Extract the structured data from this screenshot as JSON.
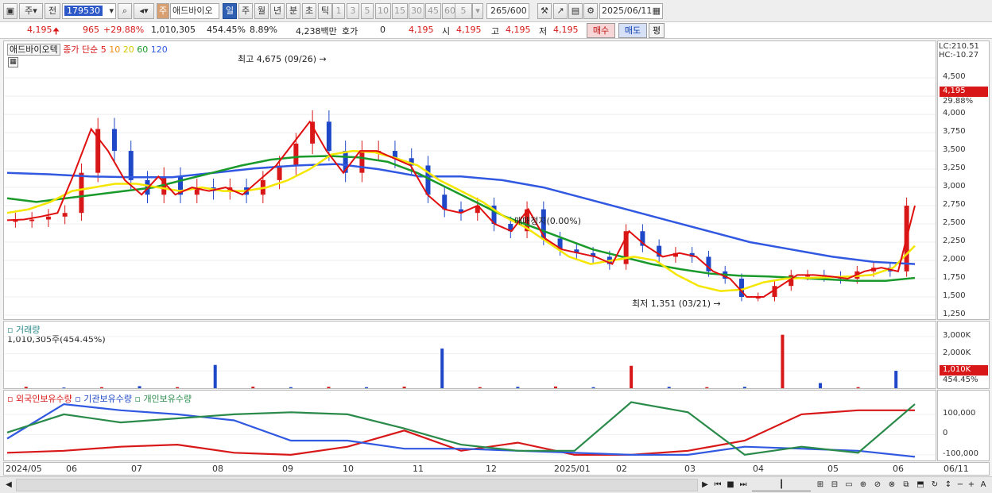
{
  "toolbar": {
    "mode_1": "주",
    "mode_2": "전",
    "code": "179530",
    "market_badge": "주",
    "name": "애드바이오",
    "periods": [
      "일",
      "주",
      "월",
      "년",
      "분",
      "초",
      "틱"
    ],
    "minutes": [
      "1",
      "3",
      "5",
      "10",
      "15",
      "30",
      "45",
      "60"
    ],
    "custom_period": "5",
    "count": "265",
    "count_max": "/600",
    "date": "2025/06/11"
  },
  "quote": {
    "price": "4,195",
    "change": "965",
    "change_pct": "+29.88%",
    "volume": "1,010,305",
    "volume_pct": "454.45%",
    "turnover": "8.89%",
    "amount": "4,238백만",
    "hoga_label": "호가",
    "hoga_value": "0",
    "open_price": "4,195",
    "open_label": "시",
    "open_value": "4,195",
    "high_label": "고",
    "high_value": "4,195",
    "low_label": "저",
    "low_value": "4,195",
    "buy_label": "매수",
    "sell_label": "매도",
    "eval_label": "평"
  },
  "price_pane": {
    "name": "애드바이오텍",
    "indicator": "종가 단순",
    "ma_periods": [
      "5",
      "10",
      "20",
      "60",
      "120"
    ],
    "high_annotation": "최고 4,675 (09/26)",
    "low_annotation": "최저 1,351 (03/21)",
    "mid_annotation": "매매정지(0.00%)",
    "lc_label": "LC:210.51",
    "hc_label": "HC:-10.27",
    "current_price_tag": "4,195",
    "current_pct_tag": "29.88%"
  },
  "volume_pane": {
    "title": "거래량",
    "subtitle": "1,010,305주(454.45%)",
    "current_tag": "1,010K",
    "current_pct_tag": "454.45%"
  },
  "holding_pane": {
    "series": [
      "외국인보유수량",
      "기관보유수량",
      "개인보유수량"
    ]
  },
  "axis": {
    "dates": [
      "2024/05",
      "06",
      "07",
      "08",
      "09",
      "10",
      "11",
      "12",
      "2025/01",
      "02",
      "03",
      "04",
      "05",
      "06",
      "06/11"
    ]
  },
  "colors": {
    "up": "#d81818",
    "down": "#1f48c8",
    "ma5": "#e01010",
    "ma10": "#f08c10",
    "ma20": "#f5e600",
    "ma60": "#1a9a2a",
    "ma120": "#3058e0",
    "foreign": "#d81818",
    "institution": "#3058e0",
    "individual": "#2a8a4a"
  },
  "chart_data": {
    "type": "candlestick",
    "title": "애드바이오텍",
    "x_range": [
      "2024-05",
      "2025-06-11"
    ],
    "ylim": [
      1250,
      4675
    ],
    "y_ticks": [
      4500,
      4250,
      4000,
      3750,
      3500,
      3250,
      3000,
      2750,
      2500,
      2250,
      2000,
      1750,
      1500,
      1250
    ],
    "y_tick_labels": [
      "4,500",
      "4,250",
      "4,000",
      "3,750",
      "3,500",
      "3,250",
      "3,000",
      "2,750",
      "2,500",
      "2,250",
      "2,000",
      "1,750",
      "1,500",
      "1,250"
    ],
    "close": [
      2550,
      2560,
      2600,
      2650,
      3200,
      3800,
      3500,
      3100,
      2900,
      3150,
      2900,
      3000,
      2950,
      3000,
      2900,
      3100,
      3300,
      3600,
      3900,
      3500,
      3200,
      3500,
      3500,
      3400,
      3300,
      2900,
      2700,
      2650,
      2750,
      2500,
      2400,
      2700,
      2300,
      2150,
      2100,
      2050,
      1950,
      2400,
      2200,
      2050,
      2100,
      2050,
      1850,
      1750,
      1500,
      1500,
      1650,
      1800,
      1800,
      1780,
      1750,
      1850,
      1900,
      1850,
      2750
    ],
    "ma_lines": {
      "20": [
        2650,
        2700,
        2800,
        2950,
        3000,
        3050,
        3050,
        3000,
        2950,
        3000,
        2950,
        2950,
        3000,
        3100,
        3250,
        3450,
        3500,
        3480,
        3400,
        3300,
        3100,
        2950,
        2800,
        2600,
        2450,
        2250,
        2050,
        1950,
        2000,
        2050,
        2000,
        1800,
        1650,
        1580,
        1600,
        1700,
        1750,
        1760,
        1770,
        1780,
        1800,
        1900,
        2200
      ],
      "60": [
        2850,
        2800,
        2850,
        2900,
        2950,
        3000,
        3100,
        3200,
        3300,
        3380,
        3420,
        3430,
        3410,
        3350,
        3200,
        3000,
        2800,
        2600,
        2450,
        2300,
        2150,
        2050,
        1950,
        1880,
        1820,
        1790,
        1780,
        1760,
        1740,
        1720,
        1720,
        1760
      ],
      "120": [
        3200,
        3180,
        3150,
        3140,
        3140,
        3200,
        3260,
        3300,
        3320,
        3250,
        3150,
        3150,
        3100,
        3000,
        2850,
        2700,
        2550,
        2400,
        2250,
        2150,
        2050,
        1980,
        1950
      ]
    },
    "y2_ticks": [
      "3,000K",
      "2,000K",
      "1,000K"
    ],
    "volume": [
      80,
      40,
      60,
      120,
      60,
      1350,
      90,
      60,
      80,
      60,
      90,
      2300,
      60,
      80,
      100,
      60,
      1300,
      80,
      60,
      80,
      3100,
      300,
      60,
      1010
    ],
    "y3_ticks": [
      "100,000",
      "0",
      "-100,000"
    ],
    "series": [
      {
        "name": "외국인보유수량",
        "values": [
          -90000,
          -80000,
          -60000,
          -50000,
          -90000,
          -100000,
          -60000,
          20000,
          -80000,
          -40000,
          -100000,
          -100000,
          -80000,
          -30000,
          100000,
          120000,
          120000
        ]
      },
      {
        "name": "기관보유수량",
        "values": [
          -20000,
          150000,
          120000,
          100000,
          70000,
          -30000,
          -30000,
          -70000,
          -70000,
          -80000,
          -90000,
          -100000,
          -100000,
          -60000,
          -70000,
          -80000,
          -110000
        ]
      },
      {
        "name": "개인보유수량",
        "values": [
          10000,
          100000,
          60000,
          80000,
          100000,
          110000,
          100000,
          30000,
          -50000,
          -80000,
          -80000,
          160000,
          110000,
          -100000,
          -60000,
          -90000,
          150000
        ]
      }
    ]
  }
}
